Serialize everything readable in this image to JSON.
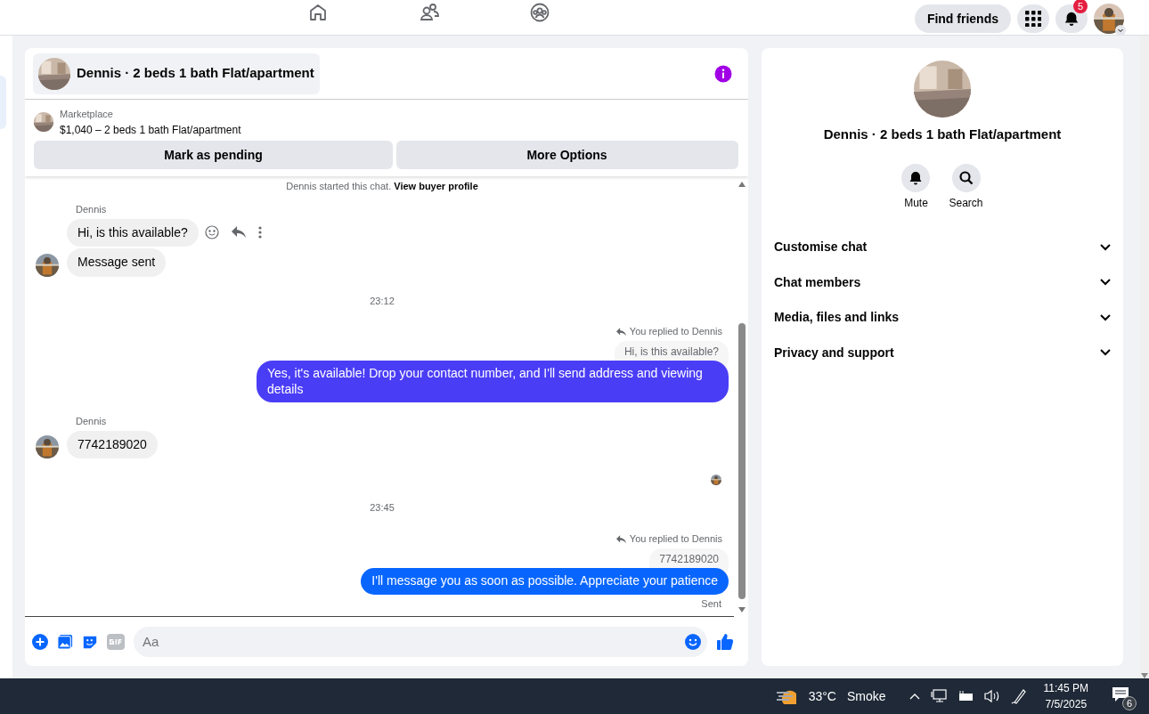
{
  "top_nav": {
    "find_friends": "Find friends",
    "notification_count": "5"
  },
  "chat": {
    "title": "Dennis · 2 beds 1 bath Flat/apartment",
    "listing": {
      "source": "Marketplace",
      "summary": "$1,040 – 2 beds 1 bath Flat/apartment"
    },
    "actions": [
      "Mark as pending",
      "More Options"
    ],
    "messages": [
      {
        "kind": "system",
        "text": "Dennis started this chat.",
        "link": "View buyer profile"
      },
      {
        "kind": "sender",
        "text": "Dennis"
      },
      {
        "kind": "in",
        "text": "Hi, is this available?",
        "avatar": false,
        "tools": true
      },
      {
        "kind": "in",
        "text": "Message sent",
        "avatar": true,
        "tools": false
      },
      {
        "kind": "time",
        "text": "23:12"
      },
      {
        "kind": "reply",
        "label": "You replied to Dennis",
        "quote": "Hi, is this available?",
        "text": "Yes, it's available! Drop your contact number, and I'll send address and viewing details",
        "color": "#4a3df6"
      },
      {
        "kind": "sender",
        "text": "Dennis"
      },
      {
        "kind": "in",
        "text": "7742189020",
        "avatar": true,
        "tools": false
      },
      {
        "kind": "seen"
      },
      {
        "kind": "time",
        "text": "23:45"
      },
      {
        "kind": "reply",
        "label": "You replied to Dennis",
        "quote": "7742189020",
        "text": "I'll message you as soon as possible. Appreciate your patience",
        "color": "#0866ff"
      },
      {
        "kind": "status",
        "text": "Sent"
      }
    ],
    "composer": {
      "placeholder": "Aa"
    }
  },
  "details": {
    "title": "Dennis · 2 beds 1 bath Flat/apartment",
    "buttons": [
      {
        "kind": "mute",
        "label": "Mute"
      },
      {
        "kind": "search",
        "label": "Search"
      }
    ],
    "sections": [
      {
        "label": "Customise chat",
        "expanded": false
      },
      {
        "label": "Chat members",
        "expanded": false
      },
      {
        "label": "Media, files and links",
        "expanded": false
      },
      {
        "label": "Privacy and support",
        "expanded": false
      }
    ]
  },
  "taskbar": {
    "temperature": "33°C",
    "weather": "Smoke",
    "time": "11:45 PM",
    "date": "7/5/2025",
    "notification_count": "6"
  }
}
